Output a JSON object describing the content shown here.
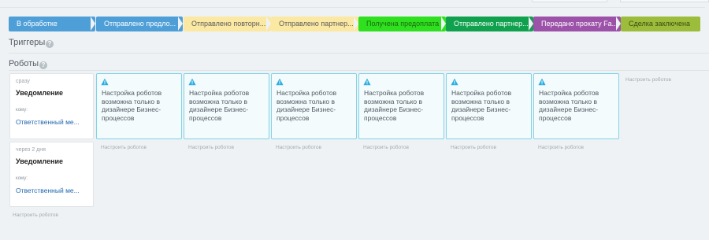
{
  "stages": [
    {
      "label": "В обработке",
      "bg": "#4e9fd8",
      "fg": "#ffffff"
    },
    {
      "label": "Отправлено предло...",
      "bg": "#4e9fd8",
      "fg": "#ffffff"
    },
    {
      "label": "Отправлено повторн...",
      "bg": "#fbe8a3",
      "fg": "#5c5c5c"
    },
    {
      "label": "Отправлено партнер...",
      "bg": "#fbe8a3",
      "fg": "#5c5c5c"
    },
    {
      "label": "Получена предоплата",
      "bg": "#2fe01f",
      "fg": "#1b6a12"
    },
    {
      "label": "Отправлено партнер...",
      "bg": "#10a14e",
      "fg": "#ffffff"
    },
    {
      "label": "Передано прокату Fa...",
      "bg": "#9c52a8",
      "fg": "#ffffff"
    },
    {
      "label": "Сделка заключена",
      "bg": "#9bbd3b",
      "fg": "#3d4b12"
    }
  ],
  "triggers": {
    "title": "Триггеры"
  },
  "robots": {
    "title": "Роботы",
    "cards": [
      {
        "when": "сразу",
        "name": "Уведомление",
        "to_label": "кому:",
        "to_value": "Ответственный ме..."
      },
      {
        "when": "через 2 дня",
        "name": "Уведомление",
        "to_label": "кому:",
        "to_value": "Ответственный ме..."
      }
    ],
    "warning_text": "Настройка роботов возможна только в дизайнере Бизнес-процессов",
    "warning_count": 6,
    "setup_label": "Настроить роботов"
  },
  "help_glyph": "?",
  "colors": {
    "warning_border": "#7fd4e8",
    "link": "#2067b0"
  }
}
